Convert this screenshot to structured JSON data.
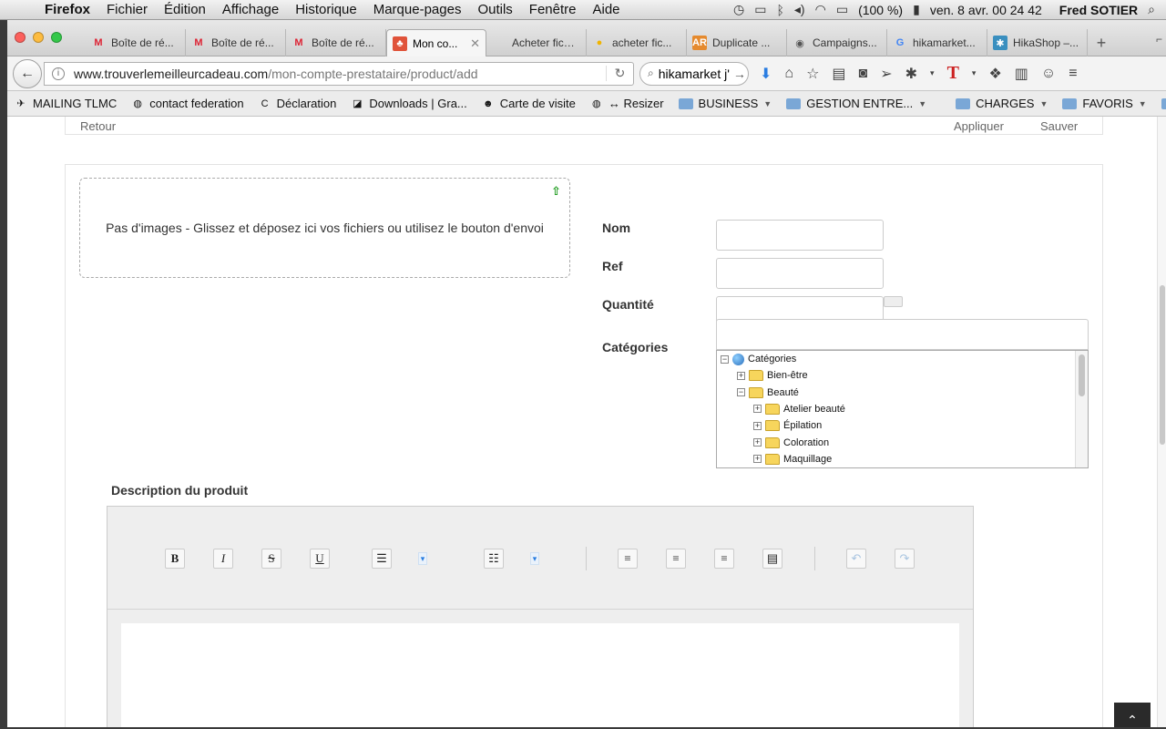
{
  "menubar": {
    "app": "Firefox",
    "items": [
      "Fichier",
      "Édition",
      "Affichage",
      "Historique",
      "Marque-pages",
      "Outils",
      "Fenêtre",
      "Aide"
    ],
    "battery": "(100 %)",
    "datetime": "ven. 8 avr.  00 24 42",
    "user": "Fred SOTIER"
  },
  "tabs": [
    {
      "label": "Boîte de ré...",
      "icon": "gmail-icon"
    },
    {
      "label": "Boîte de ré...",
      "icon": "gmail-icon"
    },
    {
      "label": "Boîte de ré...",
      "icon": "gmail-icon"
    },
    {
      "label": "Mon co...",
      "icon": "tlmc-icon",
      "active": true
    },
    {
      "label": "Acheter fichier...",
      "icon": "blank-icon"
    },
    {
      "label": "acheter fic...",
      "icon": "yellow-icon"
    },
    {
      "label": "Duplicate ...",
      "icon": "ar-icon"
    },
    {
      "label": "Campaigns...",
      "icon": "mailchimp-icon"
    },
    {
      "label": "hikamarket...",
      "icon": "google-icon"
    },
    {
      "label": "HikaShop –...",
      "icon": "hikashop-icon"
    }
  ],
  "url": {
    "host": "www.trouverlemeilleurcadeau.com",
    "path": "/mon-compte-prestataire/product/add"
  },
  "search": {
    "value": "hikamarket j'"
  },
  "bookmarks": [
    {
      "label": "MAILING TLMC",
      "type": "site"
    },
    {
      "label": "contact federation",
      "type": "site"
    },
    {
      "label": "Déclaration",
      "type": "site"
    },
    {
      "label": "Downloads | Gra...",
      "type": "site"
    },
    {
      "label": "Carte de visite",
      "type": "site"
    },
    {
      "label": "↔ Resizer",
      "type": "site"
    },
    {
      "label": "BUSINESS",
      "type": "folder"
    },
    {
      "label": "GESTION ENTRE...",
      "type": "folder"
    },
    {
      "label": "CHARGES",
      "type": "folder"
    },
    {
      "label": "FAVORIS",
      "type": "folder"
    },
    {
      "label": "EMAILS",
      "type": "folder"
    }
  ],
  "topbar": {
    "left": "Retour",
    "apply": "Appliquer",
    "save": "Sauver"
  },
  "dropzone": {
    "text": "Pas d'images - Glissez et déposez ici vos fichiers ou utilisez le bouton d'envoi"
  },
  "form": {
    "name_label": "Nom",
    "ref_label": "Ref",
    "qty_label": "Quantité",
    "cat_label": "Catégories"
  },
  "tree": [
    {
      "label": "Catégories",
      "level": 0,
      "toggle": "−",
      "kind": "root"
    },
    {
      "label": "Bien-être",
      "level": 1,
      "toggle": "+",
      "kind": "folder"
    },
    {
      "label": "Beauté",
      "level": 1,
      "toggle": "−",
      "kind": "folder"
    },
    {
      "label": "Atelier beauté",
      "level": 2,
      "toggle": "+",
      "kind": "folder"
    },
    {
      "label": "Épilation",
      "level": 2,
      "toggle": "+",
      "kind": "folder"
    },
    {
      "label": "Coloration",
      "level": 2,
      "toggle": "+",
      "kind": "folder"
    },
    {
      "label": "Maquillage",
      "level": 2,
      "toggle": "+",
      "kind": "folder"
    }
  ],
  "description": {
    "label": "Description du produit"
  },
  "editor_toolbar": {
    "bold": "B",
    "italic": "I",
    "strike": "S",
    "underline": "U"
  },
  "colors": {
    "accent": "#2a7de1",
    "upload": "#1a9a1a"
  }
}
